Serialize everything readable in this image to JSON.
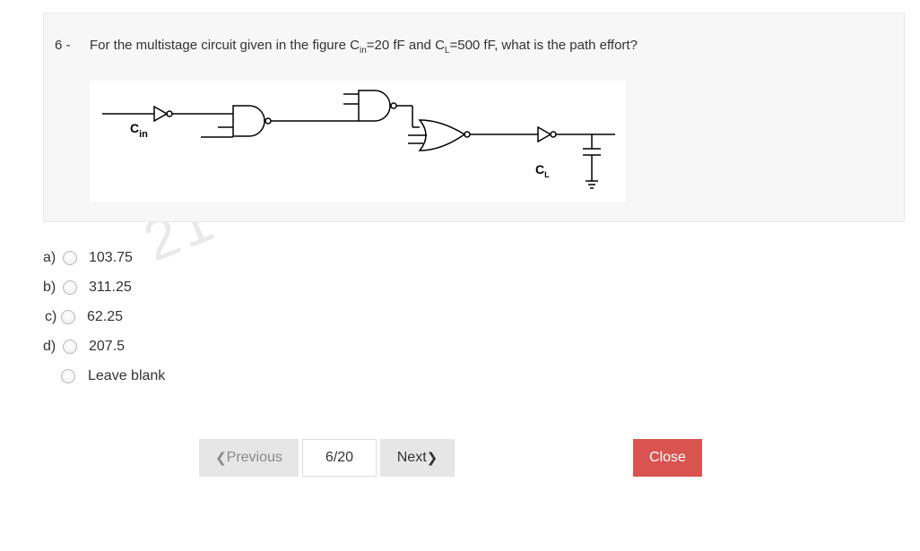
{
  "question": {
    "number": "6 -",
    "text_part1": "For the multistage circuit given in the figure C",
    "cin_sub": "in",
    "text_part2": "=20 fF and C",
    "cl_sub": "L",
    "text_part3": "=500 fF, what is the path effort?"
  },
  "figure": {
    "cin_label": "C",
    "cin_sub": "in",
    "cl_label": "C",
    "cl_sub": "L"
  },
  "watermark": "21",
  "options": [
    {
      "letter": "a)",
      "value": "103.75"
    },
    {
      "letter": "b)",
      "value": "311.25"
    },
    {
      "letter": "c)",
      "value": "62.25"
    },
    {
      "letter": "d)",
      "value": "207.5"
    },
    {
      "letter": "",
      "value": "Leave blank"
    }
  ],
  "nav": {
    "previous_label": "Previous",
    "previous_icon": "chevron-left-icon",
    "page_indicator": "6/20",
    "next_label": "Next",
    "next_icon": "chevron-right-icon",
    "close_label": "Close",
    "close_color": "#d9534f"
  }
}
